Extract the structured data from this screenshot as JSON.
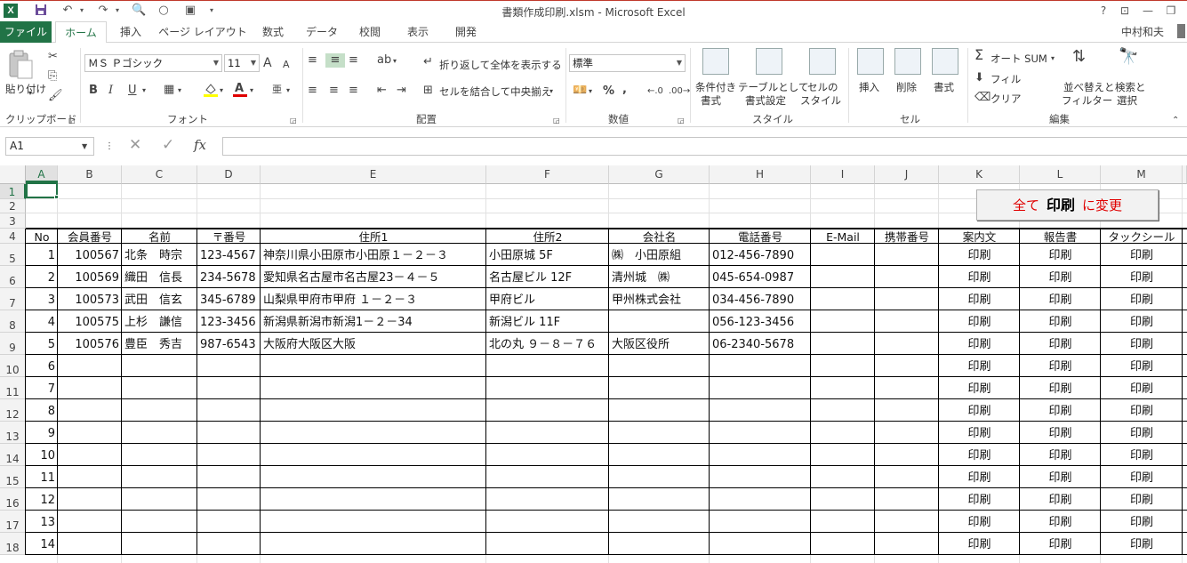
{
  "window": {
    "title": "書類作成印刷.xlsm - Microsoft Excel",
    "logo": "X",
    "help": "?"
  },
  "tabs": [
    "ファイル",
    "ホーム",
    "挿入",
    "ページ レイアウト",
    "数式",
    "データ",
    "校閲",
    "表示",
    "開発"
  ],
  "user": "中村和夫",
  "ribbon": {
    "clipboard": {
      "label": "クリップボード",
      "paste": "貼り付け"
    },
    "font": {
      "label": "フォント",
      "name": "ＭＳ Ｐゴシック",
      "size": "11",
      "bold": "B",
      "italic": "I",
      "underline": "U",
      "grow": "A",
      "shrink": "A",
      "font_color_glyph": "A",
      "phonetic": "亜"
    },
    "alignment": {
      "label": "配置",
      "wrap": "折り返して全体を表示する",
      "merge": "セルを結合して中央揃え"
    },
    "number": {
      "label": "数値",
      "format": "標準",
      "percent": "%",
      "comma": ","
    },
    "styles": {
      "label": "スタイル",
      "conditional_1": "条件付き",
      "conditional_2": "書式",
      "table_1": "テーブルとして",
      "table_2": "書式設定",
      "cell_1": "セルの",
      "cell_2": "スタイル"
    },
    "cells": {
      "label": "セル",
      "insert": "挿入",
      "delete": "削除",
      "format": "書式"
    },
    "editing": {
      "label": "編集",
      "autosum": "オート SUM",
      "fill": "フィル",
      "clear": "クリア",
      "sort_1": "並べ替えと",
      "sort_2": "フィルター",
      "find_1": "検索と",
      "find_2": "選択"
    }
  },
  "formula_bar": {
    "name_box": "A1",
    "fx": "fx",
    "value": ""
  },
  "sheet": {
    "columns": [
      "A",
      "B",
      "C",
      "D",
      "E",
      "F",
      "G",
      "H",
      "I",
      "J",
      "K",
      "L",
      "M"
    ],
    "rows": [
      "1",
      "2",
      "3",
      "4",
      "5",
      "6",
      "7",
      "8",
      "9",
      "10",
      "11",
      "12",
      "13",
      "14",
      "15",
      "16",
      "17",
      "18"
    ],
    "button": {
      "prefix": "全て",
      "main": "印刷",
      "suffix": "に変更"
    },
    "headers": [
      "No",
      "会員番号",
      "名前",
      "〒番号",
      "住所1",
      "住所2",
      "会社名",
      "電話番号",
      "E-Mail",
      "携帯番号",
      "案内文",
      "報告書",
      "タックシール"
    ],
    "records": [
      [
        "1",
        "100567",
        "北条　時宗",
        "123-4567",
        "神奈川県小田原市小田原１－２－３",
        "小田原城 5F",
        "㈱　小田原組",
        "012-456-7890",
        "",
        "",
        "印刷",
        "印刷",
        "印刷"
      ],
      [
        "2",
        "100569",
        "織田　信長",
        "234-5678",
        "愛知県名古屋市名古屋23－４－５",
        "名古屋ビル 12F",
        "清州城　㈱",
        "045-654-0987",
        "",
        "",
        "印刷",
        "印刷",
        "印刷"
      ],
      [
        "3",
        "100573",
        "武田　信玄",
        "345-6789",
        "山梨県甲府市甲府 １－２－３",
        "甲府ビル",
        "甲州株式会社",
        "034-456-7890",
        "",
        "",
        "印刷",
        "印刷",
        "印刷"
      ],
      [
        "4",
        "100575",
        "上杉　謙信",
        "123-3456",
        "新潟県新潟市新潟1－２－34",
        "新潟ビル 11F",
        "",
        "056-123-3456",
        "",
        "",
        "印刷",
        "印刷",
        "印刷"
      ],
      [
        "5",
        "100576",
        "豊臣　秀吉",
        "987-6543",
        "大阪府大阪区大阪",
        "北の丸 ９－８－７６",
        "大阪区役所",
        "06-2340-5678",
        "",
        "",
        "印刷",
        "印刷",
        "印刷"
      ],
      [
        "6",
        "",
        "",
        "",
        "",
        "",
        "",
        "",
        "",
        "",
        "印刷",
        "印刷",
        "印刷"
      ],
      [
        "7",
        "",
        "",
        "",
        "",
        "",
        "",
        "",
        "",
        "",
        "印刷",
        "印刷",
        "印刷"
      ],
      [
        "8",
        "",
        "",
        "",
        "",
        "",
        "",
        "",
        "",
        "",
        "印刷",
        "印刷",
        "印刷"
      ],
      [
        "9",
        "",
        "",
        "",
        "",
        "",
        "",
        "",
        "",
        "",
        "印刷",
        "印刷",
        "印刷"
      ],
      [
        "10",
        "",
        "",
        "",
        "",
        "",
        "",
        "",
        "",
        "",
        "印刷",
        "印刷",
        "印刷"
      ],
      [
        "11",
        "",
        "",
        "",
        "",
        "",
        "",
        "",
        "",
        "",
        "印刷",
        "印刷",
        "印刷"
      ],
      [
        "12",
        "",
        "",
        "",
        "",
        "",
        "",
        "",
        "",
        "",
        "印刷",
        "印刷",
        "印刷"
      ],
      [
        "13",
        "",
        "",
        "",
        "",
        "",
        "",
        "",
        "",
        "",
        "印刷",
        "印刷",
        "印刷"
      ],
      [
        "14",
        "",
        "",
        "",
        "",
        "",
        "",
        "",
        "",
        "",
        "印刷",
        "印刷",
        "印刷"
      ]
    ]
  }
}
